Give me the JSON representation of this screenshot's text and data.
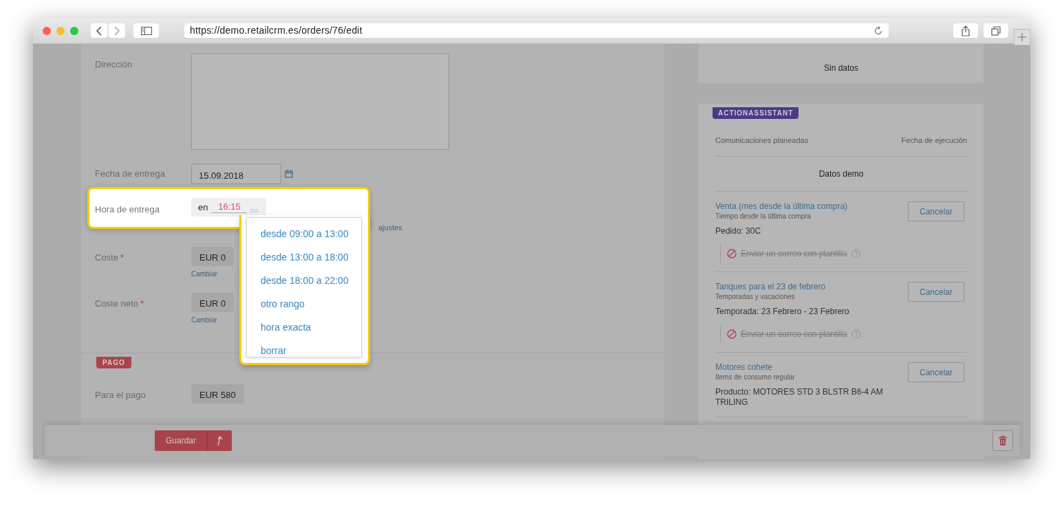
{
  "browser": {
    "url": "https://demo.retailcrm.es/orders/76/edit"
  },
  "form": {
    "fields": [
      {
        "kind": "textarea",
        "label": "Dirección"
      },
      {
        "kind": "date",
        "label": "Fecha de entrega",
        "value": "15.09.2018"
      },
      {
        "kind": "time",
        "label": "Hora de entrega",
        "prefix": "en",
        "value": "16:15",
        "hint_end": "ajustes"
      },
      {
        "kind": "money",
        "label": "Coste",
        "required_mark": "*",
        "value": "EUR 0",
        "link": "Cambiar"
      },
      {
        "kind": "money",
        "label": "Coste neto",
        "required_mark": "*",
        "value": "EUR 0",
        "link": "Cambiar"
      }
    ],
    "payment": {
      "tag": "PAGO",
      "label": "Para el pago",
      "value": "EUR 580"
    }
  },
  "time_menu": {
    "options": [
      "desde 09:00 a 13:00",
      "desde 13:00 a 18:00",
      "desde 18:00 a 22:00",
      "otro rango",
      "hora exacta",
      "borrar"
    ]
  },
  "sidebar": {
    "empty_text": "Sin datos",
    "assistant": {
      "tag": "ACTIONASSISTANT",
      "columns": [
        "Comunicaciones planeadas",
        "Fecha de ejecución"
      ],
      "demo_text": "Datos demo",
      "items": [
        {
          "title": "Venta (mes desde la última compra)",
          "subtitle": "Tiempo desde la última compra",
          "detail": "Pedido: 30C",
          "action": "Enviar un correo con plantilla",
          "cancelled": true,
          "button": "Cancelar"
        },
        {
          "title": "Tanques para el 23 de febrero",
          "subtitle": "Temporadas y vacaciones",
          "detail": "Temporada: 23 Febrero - 23 Febrero",
          "action": "Enviar un correo con plantilla",
          "cancelled": true,
          "button": "Cancelar"
        },
        {
          "title": "Motores cohete",
          "subtitle": "Items de consumo regular",
          "detail": "Producto: MOTORES STD 3 BLSTR B6-4 AM TRILING",
          "button": "Cancelar"
        }
      ]
    }
  },
  "footer": {
    "save_button": "Guardar"
  }
}
